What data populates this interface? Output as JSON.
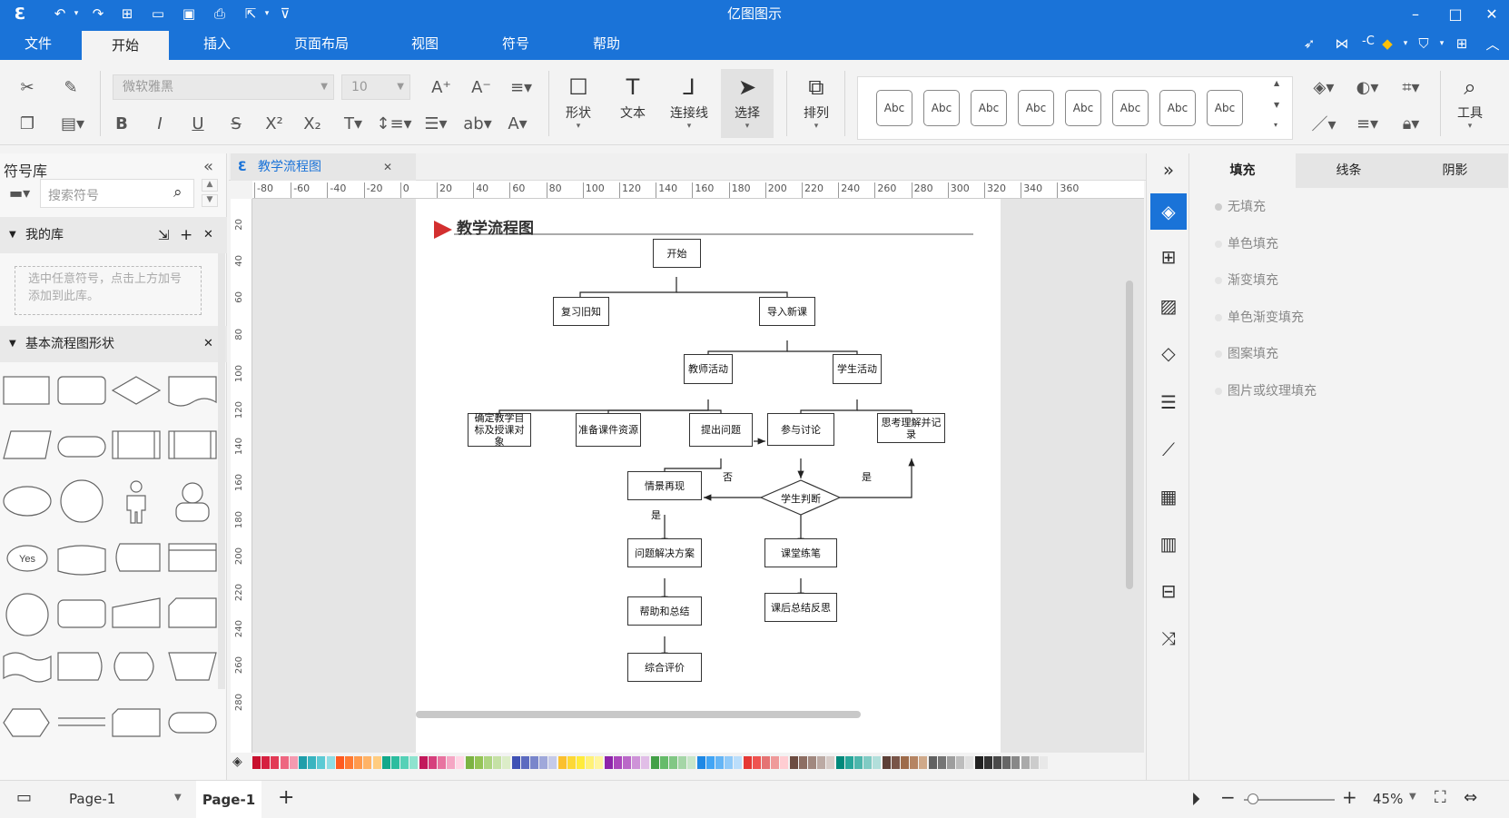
{
  "app": {
    "title": "亿图图示"
  },
  "menu": {
    "items": [
      "文件",
      "开始",
      "插入",
      "页面布局",
      "视图",
      "符号",
      "帮助"
    ],
    "active": "开始",
    "user_badge": "-C"
  },
  "ribbon": {
    "font_name": "微软雅黑",
    "font_size": "10",
    "tools": {
      "shape": "形状",
      "text": "文本",
      "connector": "连接线",
      "select": "选择",
      "arrange": "排列",
      "tools": "工具"
    },
    "style_label": "Abc"
  },
  "left_panel": {
    "title": "符号库",
    "search_placeholder": "搜索符号",
    "my_library": {
      "title": "我的库",
      "hint": "选中任意符号，点击上方加号添加到此库。"
    },
    "basic_flow": {
      "title": "基本流程图形状",
      "yes_label": "Yes"
    }
  },
  "document": {
    "tab_title": "教学流程图",
    "diagram_title": "教学流程图"
  },
  "ruler": {
    "h_ticks": [
      "-80",
      "-60",
      "-40",
      "-20",
      "0",
      "20",
      "40",
      "60",
      "80",
      "100",
      "120",
      "140",
      "160",
      "180",
      "200",
      "220",
      "240",
      "260",
      "280",
      "300",
      "320",
      "340",
      "360"
    ],
    "v_ticks": [
      "20",
      "40",
      "60",
      "80",
      "100",
      "120",
      "140",
      "160",
      "180",
      "200",
      "220",
      "240",
      "260",
      "280"
    ]
  },
  "flowchart": {
    "start": "开始",
    "review": "复习旧知",
    "new_lesson": "导入新课",
    "teacher": "教师活动",
    "student": "学生活动",
    "goal": "确定教学目标及授课对象",
    "prepare": "准备课件资源",
    "question": "提出问题",
    "discuss": "参与讨论",
    "think": "思考理解并记录",
    "scene": "情景再现",
    "judge": "学生判断",
    "solution": "问题解决方案",
    "practice": "课堂练笔",
    "help": "帮助和总结",
    "reflect": "课后总结反思",
    "evaluate": "综合评价",
    "label_no": "否",
    "label_yes_right": "是",
    "label_yes_down": "是"
  },
  "right_panel": {
    "tabs": [
      "填充",
      "线条",
      "阴影"
    ],
    "active_tab": "填充",
    "fill_options": [
      "无填充",
      "单色填充",
      "渐变填充",
      "单色渐变填充",
      "图案填充",
      "图片或纹理填充"
    ]
  },
  "status": {
    "page_selector": "Page-1",
    "page_tab": "Page-1",
    "zoom": "45%"
  },
  "palette": [
    "#c8102e",
    "#d61f3f",
    "#e23a55",
    "#ee6680",
    "#f49ab0",
    "#1f9eaa",
    "#39b4c0",
    "#5ccad4",
    "#8fdde4",
    "#ff5a1f",
    "#ff7a33",
    "#ff9a4d",
    "#ffb366",
    "#ffcc80",
    "#12a88a",
    "#2bbd9f",
    "#55d1b7",
    "#8fe3cf",
    "#c2185b",
    "#d63f7d",
    "#e873a0",
    "#f5a6c4",
    "#ffd6e5",
    "#7cb342",
    "#94c456",
    "#aed581",
    "#c5e1a5",
    "#dcedc8",
    "#3f51b5",
    "#5c6bc0",
    "#7986cb",
    "#9fa8da",
    "#c5cae9",
    "#fbc02d",
    "#fdd835",
    "#ffeb3b",
    "#fff176",
    "#fff59d",
    "#8e24aa",
    "#ab47bc",
    "#ba68c8",
    "#ce93d8",
    "#e1bee7",
    "#43a047",
    "#66bb6a",
    "#81c784",
    "#a5d6a7",
    "#c8e6c9",
    "#1e88e5",
    "#42a5f5",
    "#64b5f6",
    "#90caf9",
    "#bbdefb",
    "#e53935",
    "#ef5350",
    "#e57373",
    "#ef9a9a",
    "#ffcdd2",
    "#6d4c41",
    "#8d6e63",
    "#a1887f",
    "#bcaaa4",
    "#d7ccc8",
    "#00897b",
    "#26a69a",
    "#4db6ac",
    "#80cbc4",
    "#b2dfdb",
    "#5d4037",
    "#795548",
    "#9e6b4a",
    "#b58463",
    "#cfa98a",
    "#616161",
    "#757575",
    "#9e9e9e",
    "#bdbdbd",
    "#e0e0e0",
    "#212121",
    "#333333",
    "#4a4a4a",
    "#666666",
    "#888888",
    "#aaaaaa",
    "#cccccc",
    "#e8e8e8"
  ]
}
